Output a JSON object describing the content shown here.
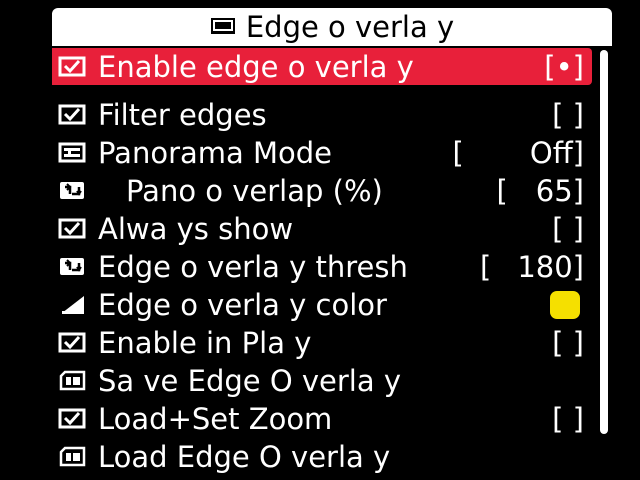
{
  "title": {
    "text": "Edge o verla y",
    "icon": "screen-icon"
  },
  "selection_color": "#e8203a",
  "swatch_color": "#f5e000",
  "items": [
    {
      "id": "enable-edge-overlay",
      "icon": "checkbox-icon",
      "label": "Enable edge o verla y",
      "open": "",
      "value": "[•]",
      "selected": true
    },
    {
      "id": "filter-edges",
      "icon": "checkbox-icon",
      "label": "Filter edges",
      "open": "",
      "value": "[  ]"
    },
    {
      "id": "panorama-mode",
      "icon": "list-icon",
      "label": "Panorama Mode",
      "open": "[",
      "value": "Off]"
    },
    {
      "id": "pano-overlap",
      "icon": "stepper-icon",
      "label": "Pano o verlap (%)",
      "open": "[",
      "value": "65]",
      "indent": true
    },
    {
      "id": "always-show",
      "icon": "checkbox-icon",
      "label": "Alwa ys show",
      "open": "",
      "value": "[  ]"
    },
    {
      "id": "edge-overlay-thresh",
      "icon": "stepper-icon",
      "label": "Edge o verla y thresh",
      "open": "[",
      "value": "180]"
    },
    {
      "id": "edge-overlay-color",
      "icon": "color-icon",
      "label": "Edge o verla y color",
      "open": "",
      "value": ""
    },
    {
      "id": "enable-in-play",
      "icon": "checkbox-icon",
      "label": "Enable in Pla y",
      "open": "",
      "value": "[  ]"
    },
    {
      "id": "save-edge-overlay",
      "icon": "sd-card-icon",
      "label": "Sa ve Edge O verla y",
      "open": "",
      "value": ""
    },
    {
      "id": "load-set-zoom",
      "icon": "checkbox-icon",
      "label": "Load+Set Zoom",
      "open": "",
      "value": "[  ]"
    },
    {
      "id": "load-edge-overlay",
      "icon": "sd-card-icon",
      "label": "Load Edge O verla y",
      "open": "",
      "value": ""
    }
  ]
}
